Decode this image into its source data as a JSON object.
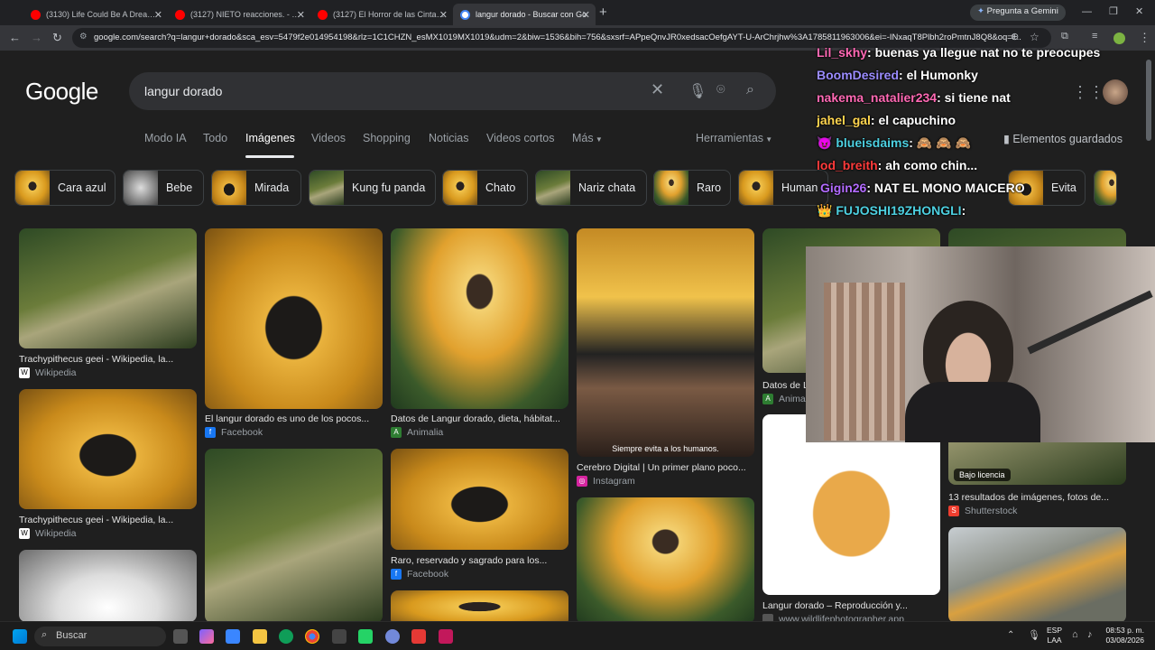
{
  "browser": {
    "tabs": [
      {
        "title": "(3130) Life Could Be A Dream -",
        "color": "#ff0000"
      },
      {
        "title": "(3127) NIETO reacciones. - You",
        "color": "#ff0000"
      },
      {
        "title": "(3127) El Horror de las Cintas B",
        "color": "#ff0000"
      },
      {
        "title": "langur dorado - Buscar con Go",
        "color": "#4285f4"
      }
    ],
    "new_tab": "+",
    "gemini": "Pregunta a Gemini",
    "url": "google.com/search?q=langur+dorado&sca_esv=5479f2e014954198&rlz=1C1CHZN_esMX1019MX1019&udm=2&biw=1536&bih=756&sxsrf=APpeQnvJR0xedsacOefgAYT-U-ArChrjhw%3A1785811963006&ei=-INxaqT8Plbh2roPmtnJ8Q8&oq=l..."
  },
  "google": {
    "logo": "Google",
    "query": "langur dorado",
    "nav": [
      "Modo IA",
      "Todo",
      "Imágenes",
      "Videos",
      "Shopping",
      "Noticias",
      "Videos cortos",
      "Más"
    ],
    "tools": "Herramientas",
    "saved": "Elementos guardados",
    "chips": [
      "Cara azul",
      "Bebe",
      "Mirada",
      "Kung fu panda",
      "Chato",
      "Nariz chata",
      "Raro",
      "Human",
      "Evita"
    ]
  },
  "results": [
    {
      "caption": "Trachypithecus geei - Wikipedia, la...",
      "source": "Wikipedia"
    },
    {
      "caption": "El langur dorado es uno de los pocos...",
      "source": "Facebook"
    },
    {
      "caption": "Datos de Langur dorado, dieta, hábitat...",
      "source": "Animalia"
    },
    {
      "caption": "Cerebro Digital | Un primer plano poco...",
      "source": "Instagram",
      "overlay": "Siempre evita a los humanos."
    },
    {
      "caption": "Datos de L",
      "source": "Anima"
    },
    {
      "caption": "13 resultados de imágenes, fotos de...",
      "source": "Shutterstock",
      "badge": "Bajo licencia"
    },
    {
      "caption": "Trachypithecus geei - Wikipedia, la...",
      "source": "Wikipedia"
    },
    {
      "caption": "Raro, reservado y sagrado para los...",
      "source": "Facebook"
    },
    {
      "caption": "Langur dorado – Reproducción y...",
      "source": "www.wildlifephotographer.app"
    }
  ],
  "chat": [
    {
      "user": "Lil_skhy",
      "msg": ": buenas ya llegue nat no te preocupes",
      "color": "#ff69b4"
    },
    {
      "user": "BoomDesired",
      "msg": ": el Humonky",
      "color": "#9b8cff"
    },
    {
      "user": "nakema_natalier234",
      "msg": ": si tiene nat",
      "color": "#ff69b4"
    },
    {
      "user": "jahel_gal",
      "msg": ": el capuchino",
      "color": "#ffd54f"
    },
    {
      "user": "blueisdaims",
      "msg": ": 🙈 🙈 🙈",
      "color": "#4dd0e1"
    },
    {
      "user": "lod_breith",
      "msg": ": ah como chin...",
      "color": "#ff3b3b"
    },
    {
      "user": "Gigin26",
      "msg": ": NAT EL MONO MAICERO",
      "color": "#b36bff"
    },
    {
      "user": "FUJOSHI19ZHONGLI",
      "msg": ":",
      "color": "#4dd0e1"
    }
  ],
  "taskbar": {
    "search": "Buscar",
    "lang1": "ESP",
    "lang2": "LAA",
    "time": "08:53 p. m.",
    "date": "03/08/2026"
  }
}
